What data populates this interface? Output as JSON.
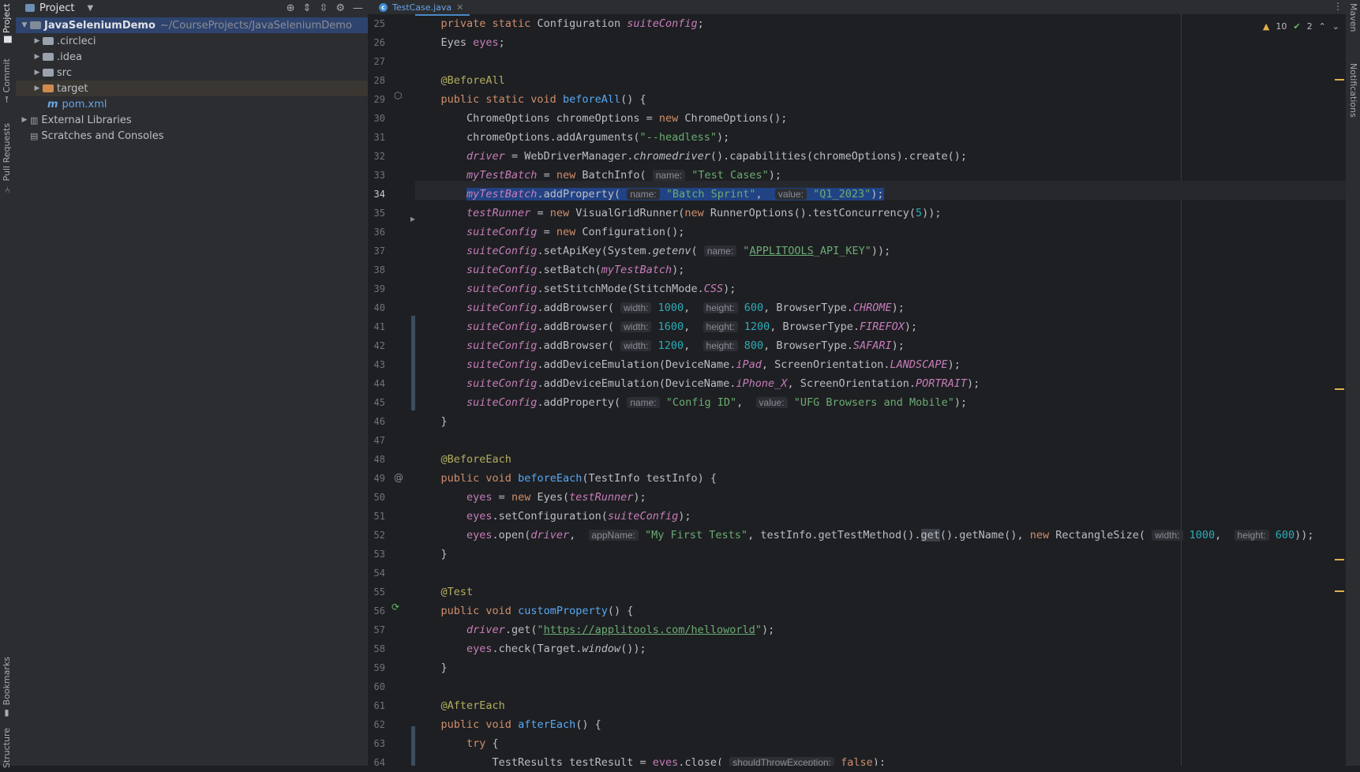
{
  "project_panel": {
    "title": "Project",
    "tree": [
      {
        "label": "JavaSeleniumDemo",
        "path": "~/CourseProjects/JavaSeleniumDemo"
      },
      {
        "label": ".circleci"
      },
      {
        "label": ".idea"
      },
      {
        "label": "src"
      },
      {
        "label": "target"
      },
      {
        "label": "pom.xml"
      },
      {
        "label": "External Libraries"
      },
      {
        "label": "Scratches and Consoles"
      }
    ]
  },
  "left_tool_tabs": [
    "Project",
    "Commit",
    "Pull Requests",
    "Bookmarks",
    "Structure"
  ],
  "right_tool_tabs": [
    "Maven",
    "Notifications"
  ],
  "editor": {
    "tab_label": "TestCase.java",
    "warnings": "10",
    "checks": "2",
    "line_numbers": [
      "25",
      "26",
      "27",
      "28",
      "29",
      "30",
      "31",
      "32",
      "33",
      "34",
      "35",
      "36",
      "37",
      "38",
      "39",
      "40",
      "41",
      "42",
      "43",
      "44",
      "45",
      "46",
      "47",
      "48",
      "49",
      "50",
      "51",
      "52",
      "53",
      "54",
      "55",
      "56",
      "57",
      "58",
      "59",
      "60",
      "61",
      "62",
      "63",
      "64"
    ],
    "current_line": "34"
  },
  "colors": {
    "background": "#1e1f22",
    "panel": "#2b2d30",
    "keyword": "#cf8e6d",
    "string": "#6aab73",
    "number": "#2aacb8",
    "field": "#c77dbb",
    "annotation": "#b3ae60",
    "method": "#56a8f5",
    "selection": "#214283"
  }
}
